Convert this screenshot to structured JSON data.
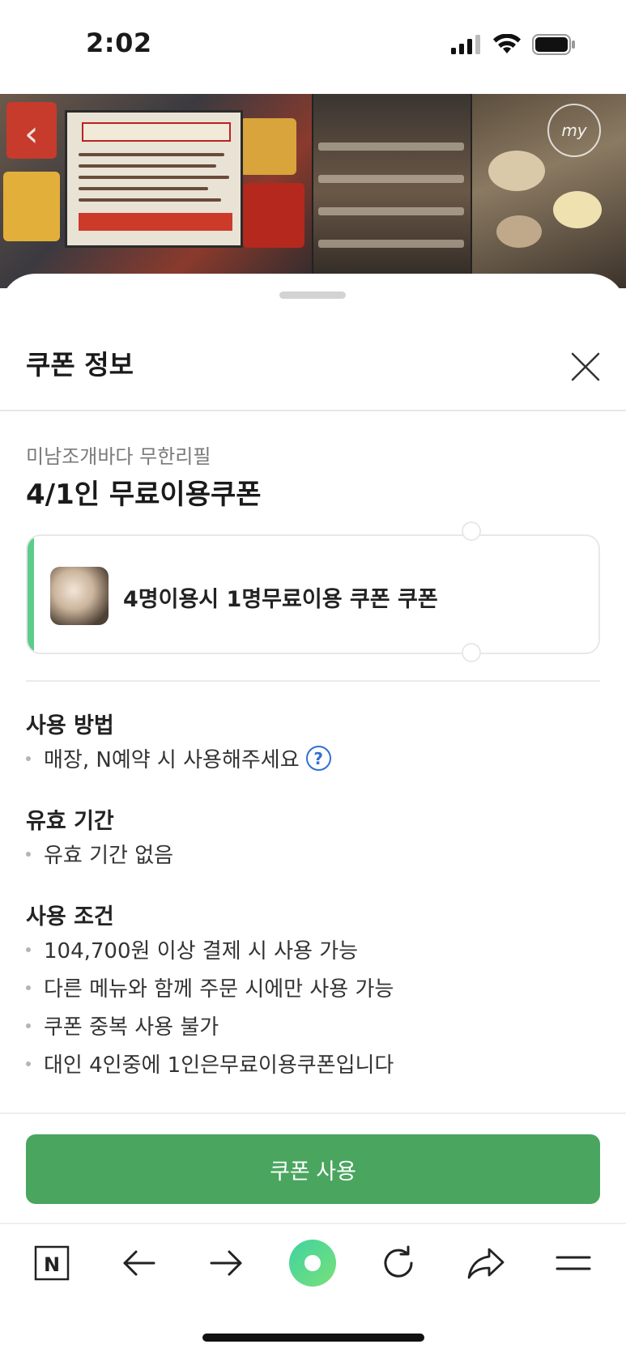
{
  "status_bar": {
    "time": "2:02"
  },
  "header": {
    "badge_text": "my"
  },
  "sheet": {
    "title": "쿠폰 정보",
    "store_name": "미남조개바다 무한리필",
    "coupon_title": "4/1인 무료이용쿠폰",
    "coupon_card": {
      "name": "4명이용시 1명무료이용 쿠폰 쿠폰",
      "accent_color": "#5ccc8a"
    },
    "sections": {
      "usage": {
        "heading": "사용 방법",
        "items": [
          "매장, N예약 시 사용해주세요"
        ]
      },
      "validity": {
        "heading": "유효 기간",
        "items": [
          "유효 기간 없음"
        ]
      },
      "conditions": {
        "heading": "사용 조건",
        "items": [
          "104,700원 이상 결제 시 사용 가능",
          "다른 메뉴와 함께 주문 시에만 사용 가능",
          "쿠폰 중복 사용 불가",
          "대인 4인중에 1인은무료이용쿠폰입니다"
        ]
      }
    },
    "use_button_label": "쿠폰 사용",
    "button_color": "#4aa55f"
  },
  "toolbar": {
    "icons": [
      "naver-home-icon",
      "back-arrow-icon",
      "forward-arrow-icon",
      "green-dot-icon",
      "refresh-icon",
      "share-icon",
      "menu-icon"
    ],
    "home_label": "N"
  }
}
